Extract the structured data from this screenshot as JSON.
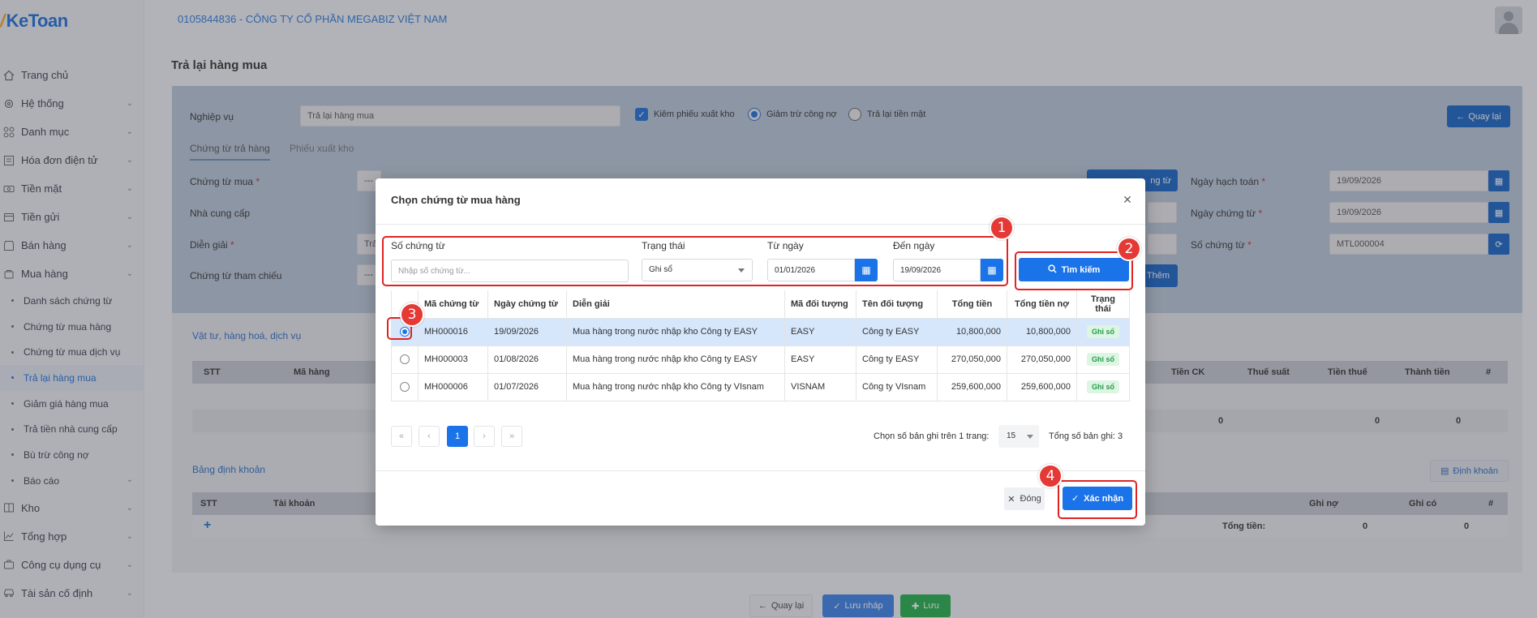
{
  "app": {
    "logo": "KeToan",
    "company": "0105844836 - CÔNG TY CỔ PHẦN MEGABIZ VIỆT NAM"
  },
  "sidebar": {
    "items": [
      {
        "label": "Trang chủ",
        "icon": "home-icon",
        "expandable": false
      },
      {
        "label": "Hệ thống",
        "icon": "gear-icon",
        "expandable": true
      },
      {
        "label": "Danh mục",
        "icon": "grid-icon",
        "expandable": true
      },
      {
        "label": "Hóa đơn điện tử",
        "icon": "invoice-icon",
        "expandable": true
      },
      {
        "label": "Tiền mặt",
        "icon": "cash-icon",
        "expandable": true
      },
      {
        "label": "Tiền gửi",
        "icon": "bank-icon",
        "expandable": true
      },
      {
        "label": "Bán hàng",
        "icon": "store-icon",
        "expandable": true
      },
      {
        "label": "Mua hàng",
        "icon": "cart-icon",
        "expandable": true
      }
    ],
    "sub_items": [
      {
        "label": "Danh sách chứng từ",
        "active": false
      },
      {
        "label": "Chứng từ mua hàng",
        "active": false
      },
      {
        "label": "Chứng từ mua dịch vụ",
        "active": false
      },
      {
        "label": "Trả lại hàng mua",
        "active": true
      },
      {
        "label": "Giảm giá hàng mua",
        "active": false
      },
      {
        "label": "Trả tiền nhà cung cấp",
        "active": false
      },
      {
        "label": "Bù trừ công nợ",
        "active": false
      },
      {
        "label": "Báo cáo",
        "active": false
      }
    ],
    "items_after": [
      {
        "label": "Kho",
        "icon": "warehouse-icon"
      },
      {
        "label": "Tổng hợp",
        "icon": "chart-icon"
      },
      {
        "label": "Công cụ dụng cụ",
        "icon": "tools-icon"
      },
      {
        "label": "Tài sản cố định",
        "icon": "car-icon"
      }
    ]
  },
  "page": {
    "title": "Trả lại hàng mua",
    "nghiep_vu_label": "Nghiệp vụ",
    "nghiep_vu_value": "Trả lại hàng mua",
    "kiem_phieu": "Kiêm phiếu xuất kho",
    "giam_tru": "Giảm trừ công nợ",
    "tra_lai_tien": "Trả lại tiền mặt",
    "quay_lai": "Quay lại",
    "tabs": [
      "Chứng từ trả hàng",
      "Phiếu xuất kho"
    ],
    "chung_tu_mua": "Chứng từ mua",
    "nha_cung_cap": "Nhà cung cấp",
    "dien_giai": "Diễn giải",
    "chung_tu_tham_chieu": "Chứng từ tham chiếu",
    "chon_chung_tu_btn": "ng từ",
    "them_btn": "Thêm",
    "ngay_hach_toan": "Ngày hạch toán",
    "ngay_hach_toan_value": "19/09/2026",
    "ngay_chung_tu": "Ngày chứng từ",
    "ngay_chung_tu_value": "19/09/2026",
    "so_chung_tu": "Số chứng từ",
    "so_chung_tu_value": "MTL000004",
    "dash": "---",
    "tra_partial": "Trả",
    "items_section": "Vật tư, hàng hoá, dịch vụ",
    "items_columns": [
      "STT",
      "Mã hàng",
      "Tiền CK",
      "Thuế suất",
      "Tiền thuế",
      "Thành tiền",
      "#"
    ],
    "items_totals": [
      "0",
      "0",
      "0"
    ],
    "accounting_section": "Bảng định khoản",
    "dinh_khoan_btn": "Định khoản",
    "acc_columns": [
      "STT",
      "Tài khoản",
      "Ghi nợ",
      "Ghi có",
      "#"
    ],
    "acc_total_label": "Tổng tiền:",
    "acc_totals": [
      "0",
      "0"
    ],
    "footer": {
      "back": "Quay lại",
      "draft": "Lưu nháp",
      "save": "Lưu"
    }
  },
  "modal": {
    "title": "Chọn chứng từ mua hàng",
    "filters": {
      "so_chung_tu_label": "Số chứng từ",
      "so_chung_tu_placeholder": "Nhập số chứng từ...",
      "trang_thai_label": "Trạng thái",
      "trang_thai_value": "Ghi sổ",
      "tu_ngay_label": "Từ ngày",
      "tu_ngay_value": "01/01/2026",
      "den_ngay_label": "Đến ngày",
      "den_ngay_value": "19/09/2026"
    },
    "search_btn": "Tìm kiếm",
    "columns": [
      "Mã chứng từ",
      "Ngày chứng từ",
      "Diễn giải",
      "Mã đối tượng",
      "Tên đối tượng",
      "Tổng tiền",
      "Tổng tiền nợ",
      "Trạng thái"
    ],
    "rows": [
      {
        "selected": true,
        "ma": "MH000016",
        "ngay": "19/09/2026",
        "dien_giai": "Mua hàng trong nước nhập kho Công ty EASY",
        "ma_dt": "EASY",
        "ten_dt": "Công ty EASY",
        "tong": "10,800,000",
        "no": "10,800,000",
        "trang_thai": "Ghi sổ"
      },
      {
        "selected": false,
        "ma": "MH000003",
        "ngay": "01/08/2026",
        "dien_giai": "Mua hàng trong nước nhập kho Công ty EASY",
        "ma_dt": "EASY",
        "ten_dt": "Công ty EASY",
        "tong": "270,050,000",
        "no": "270,050,000",
        "trang_thai": "Ghi sổ"
      },
      {
        "selected": false,
        "ma": "MH000006",
        "ngay": "01/07/2026",
        "dien_giai": "Mua hàng trong nước nhập kho Công ty VIsnam",
        "ma_dt": "VISNAM",
        "ten_dt": "Công ty VIsnam",
        "tong": "259,600,000",
        "no": "259,600,000",
        "trang_thai": "Ghi sổ"
      }
    ],
    "pagination": {
      "current": "1",
      "per_page_label": "Chọn số bản ghi trên 1 trang:",
      "per_page": "15",
      "total_label": "Tổng số bản ghi:",
      "total": "3"
    },
    "close_btn": "Đóng",
    "confirm_btn": "Xác nhận"
  },
  "annotations": [
    "1",
    "2",
    "3",
    "4"
  ],
  "colors": {
    "primary": "#1a73e8",
    "annotation": "#e02424",
    "badge_bg": "#dff5e4",
    "badge_text": "#1f9e4a"
  }
}
